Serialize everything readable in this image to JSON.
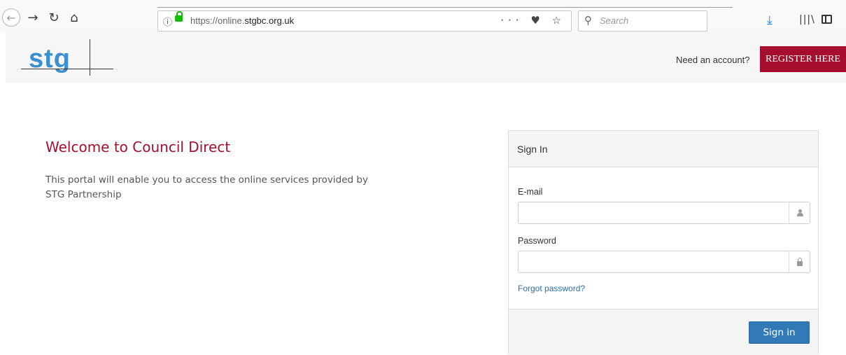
{
  "browser": {
    "url_prefix": "https://online.",
    "url_domain": "stgbc.org.uk",
    "url_actions": "··· ♥ ☆",
    "search_placeholder": "Search"
  },
  "header": {
    "logo_text": "stg",
    "need_account": "Need an account?",
    "register_label": "REGISTER HERE"
  },
  "main": {
    "title": "Welcome to Council Direct",
    "description": "This portal will enable you to access the online services provided by STG Partnership"
  },
  "signin": {
    "title": "Sign In",
    "email_label": "E-mail",
    "email_value": "",
    "password_label": "Password",
    "password_value": "",
    "forgot_label": "Forgot password?",
    "submit_label": "Sign in"
  },
  "colors": {
    "brand": "#a50f2d",
    "primary": "#3279b7",
    "logo": "#3a8fd1"
  }
}
